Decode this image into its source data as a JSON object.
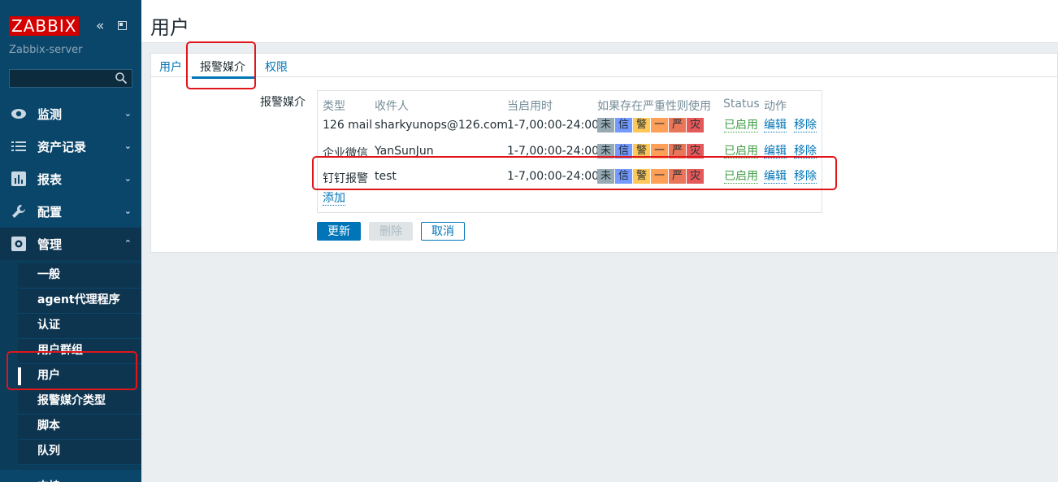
{
  "sidebar": {
    "logo": "ZABBIX",
    "server_name": "Zabbix-server",
    "search_placeholder": "",
    "menu": [
      {
        "label": "监测",
        "icon": "eye-icon"
      },
      {
        "label": "资产记录",
        "icon": "list-icon"
      },
      {
        "label": "报表",
        "icon": "bar-chart-icon"
      },
      {
        "label": "配置",
        "icon": "wrench-icon"
      },
      {
        "label": "管理",
        "icon": "gear-icon"
      }
    ],
    "admin_submenu": [
      "一般",
      "agent代理程序",
      "认证",
      "用户群组",
      "用户",
      "报警媒介类型",
      "脚本",
      "队列"
    ],
    "bottom_item": "支持"
  },
  "header": {
    "title": "用户"
  },
  "tabs": [
    {
      "label": "用户"
    },
    {
      "label": "报警媒介"
    },
    {
      "label": "权限"
    }
  ],
  "form": {
    "field_label": "报警媒介",
    "columns": [
      "类型",
      "收件人",
      "当启用时",
      "如果存在严重性则使用",
      "Status",
      "动作"
    ],
    "rows": [
      {
        "type": "126 mail",
        "recipient": "sharkyunops@126.com",
        "when_active": "1-7,00:00-24:00",
        "status": "已启用",
        "edit": "编辑",
        "remove": "移除"
      },
      {
        "type": "企业微信",
        "recipient": "YanSunJun",
        "when_active": "1-7,00:00-24:00",
        "status": "已启用",
        "edit": "编辑",
        "remove": "移除"
      },
      {
        "type": "钉钉报警",
        "recipient": "test",
        "when_active": "1-7,00:00-24:00",
        "status": "已启用",
        "edit": "编辑",
        "remove": "移除"
      }
    ],
    "severity_labels": [
      "未",
      "信",
      "警",
      "一",
      "严",
      "灾"
    ],
    "severity_colors": [
      "#97aab3",
      "#7499ff",
      "#ffc859",
      "#ffa059",
      "#e97659",
      "#e45959"
    ],
    "add_link": "添加"
  },
  "buttons": {
    "update": "更新",
    "delete": "删除",
    "cancel": "取消"
  }
}
